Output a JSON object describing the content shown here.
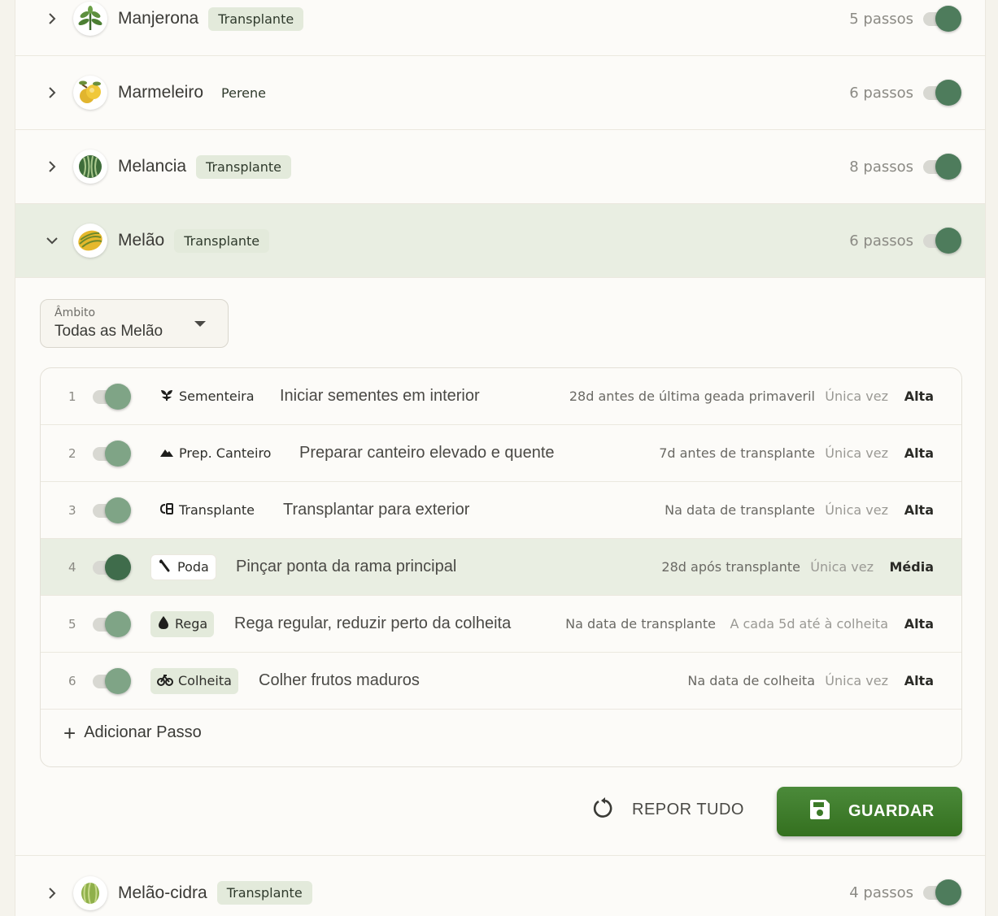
{
  "crops": [
    {
      "name": "Manjerona",
      "badge": "Transplante",
      "steps": "5 passos",
      "icon": "herb-icon"
    },
    {
      "name": "Marmeleiro",
      "badge": "Perene",
      "steps": "6 passos",
      "icon": "quince-icon"
    },
    {
      "name": "Melancia",
      "badge": "Transplante",
      "steps": "8 passos",
      "icon": "watermelon-icon"
    },
    {
      "name": "Melão",
      "badge": "Transplante",
      "steps": "6 passos",
      "icon": "melon-icon"
    },
    {
      "name": "Melão-cidra",
      "badge": "Transplante",
      "steps": "4 passos",
      "icon": "citron-melon-icon"
    }
  ],
  "scope": {
    "label": "Âmbito",
    "value": "Todas as Melão"
  },
  "step_list": [
    {
      "num": "1",
      "type": "Sementeira",
      "type_icon": "seedling-icon",
      "title": "Iniciar sementes em interior",
      "timing": "28d antes de última geada primaveril",
      "freq": "Única vez",
      "priority": "Alta"
    },
    {
      "num": "2",
      "type": "Prep. Canteiro",
      "type_icon": "terrain-icon",
      "title": "Preparar canteiro elevado e quente",
      "timing": "7d antes de transplante",
      "freq": "Única vez",
      "priority": "Alta"
    },
    {
      "num": "3",
      "type": "Transplante",
      "type_icon": "transplant-icon",
      "title": "Transplantar para exterior",
      "timing": "Na data de transplante",
      "freq": "Única vez",
      "priority": "Alta"
    },
    {
      "num": "4",
      "type": "Poda",
      "type_icon": "pruning-icon",
      "title": "Pinçar ponta da rama principal",
      "timing": "28d após transplante",
      "freq": "Única vez",
      "priority": "Média"
    },
    {
      "num": "5",
      "type": "Rega",
      "type_icon": "water-drop-icon",
      "title": "Rega regular, reduzir perto da colheita",
      "timing": "Na data de transplante",
      "freq": "A cada 5d até à colheita",
      "priority": "Alta"
    },
    {
      "num": "6",
      "type": "Colheita",
      "type_icon": "harvest-icon",
      "title": "Colher frutos maduros",
      "timing": "Na data de colheita",
      "freq": "Única vez",
      "priority": "Alta"
    }
  ],
  "add_step_label": "Adicionar Passo",
  "reset_label": "REPOR TUDO",
  "save_label": "GUARDAR"
}
